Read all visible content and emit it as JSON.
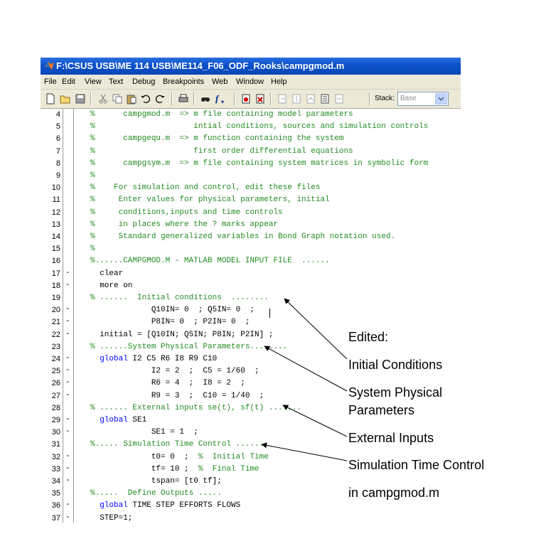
{
  "window": {
    "title": "F:\\CSUS USB\\ME 114 USB\\ME114_F06_ODF_Rooks\\campgmod.m"
  },
  "menu": [
    "File",
    "Edit",
    "View",
    "Text",
    "Debug",
    "Breakpoints",
    "Web",
    "Window",
    "Help"
  ],
  "toolbar": {
    "stack_label": "Stack:",
    "stack_value": "Base",
    "icons": [
      "new-file-icon",
      "open-folder-icon",
      "save-icon",
      "cut-icon",
      "copy-icon",
      "paste-icon",
      "undo-icon",
      "redo-icon",
      "print-icon",
      "find-icon",
      "function-icon",
      "set-breakpoint-icon",
      "clear-breakpoint-icon",
      "step-icon",
      "step-in-icon",
      "step-out-icon",
      "continue-icon",
      "exit-debug-icon"
    ]
  },
  "editor": {
    "lines": [
      {
        "num": "4",
        "dash": "",
        "code": "%      campgmod.m  => m file containing model parameters",
        "type": "comment"
      },
      {
        "num": "5",
        "dash": "",
        "code": "%                     intial conditions, sources and simulation controls",
        "type": "comment"
      },
      {
        "num": "6",
        "dash": "",
        "code": "%      campgequ.m  => m function containing the system",
        "type": "comment"
      },
      {
        "num": "7",
        "dash": "",
        "code": "%                     first order differential equations",
        "type": "comment"
      },
      {
        "num": "8",
        "dash": "",
        "code": "%      campgsym.m  => m file containing system matrices in symbolic form",
        "type": "comment"
      },
      {
        "num": "9",
        "dash": "",
        "code": "%",
        "type": "comment"
      },
      {
        "num": "10",
        "dash": "",
        "code": "%    For simulation and control, edit these files",
        "type": "comment"
      },
      {
        "num": "11",
        "dash": "",
        "code": "%     Enter values for physical parameters, initial",
        "type": "comment"
      },
      {
        "num": "12",
        "dash": "",
        "code": "%     conditions,inputs and time controls",
        "type": "comment"
      },
      {
        "num": "13",
        "dash": "",
        "code": "%     in places where the ? marks appear",
        "type": "comment"
      },
      {
        "num": "14",
        "dash": "",
        "code": "%     Standard generalized variables in Bond Graph notation used.",
        "type": "comment"
      },
      {
        "num": "15",
        "dash": "",
        "code": "%",
        "type": "comment"
      },
      {
        "num": "16",
        "dash": "",
        "code": "%......CAMPGMOD.M - MATLAB MODEL INPUT FILE  ......",
        "type": "comment"
      },
      {
        "num": "17",
        "dash": "-",
        "code": "  clear",
        "type": "code"
      },
      {
        "num": "18",
        "dash": "-",
        "code": "  more on",
        "type": "code"
      },
      {
        "num": "19",
        "dash": "",
        "code": "% ......  Initial conditions  ........",
        "type": "comment"
      },
      {
        "num": "20",
        "dash": "-",
        "code": "             Q10IN= 0  ; Q5IN= 0  ;",
        "type": "code"
      },
      {
        "num": "21",
        "dash": "-",
        "code": "             P8IN= 0  ; P2IN= 0  ;",
        "type": "code"
      },
      {
        "num": "22",
        "dash": "-",
        "code": "  initial = [Q10IN; Q5IN; P8IN; P2IN] ;",
        "type": "code"
      },
      {
        "num": "23",
        "dash": "",
        "code": "% ......System Physical Parameters........",
        "type": "comment"
      },
      {
        "num": "24",
        "dash": "-",
        "code": "  global I2 C5 R6 I8 R9 C10",
        "type": "global",
        "kw": "global",
        "rest": " I2 C5 R6 I8 R9 C10"
      },
      {
        "num": "25",
        "dash": "-",
        "code": "             I2 = 2  ;  C5 = 1/60  ;",
        "type": "code"
      },
      {
        "num": "26",
        "dash": "-",
        "code": "             R6 = 4  ;  I8 = 2  ;",
        "type": "code"
      },
      {
        "num": "27",
        "dash": "-",
        "code": "             R9 = 3  ;  C10 = 1/40  ;",
        "type": "code"
      },
      {
        "num": "28",
        "dash": "",
        "code": "% ...... External inputs se(t), sf(t) .......",
        "type": "comment"
      },
      {
        "num": "29",
        "dash": "-",
        "code": "  global SE1",
        "type": "global",
        "kw": "global",
        "rest": " SE1"
      },
      {
        "num": "30",
        "dash": "-",
        "code": "             SE1 = 1  ;",
        "type": "code"
      },
      {
        "num": "31",
        "dash": "",
        "code": "%..... Simulation Time Control ......",
        "type": "comment"
      },
      {
        "num": "32",
        "dash": "-",
        "code": "             t0= 0  ;  ",
        "type": "mixed",
        "comment": "%  Initial Time"
      },
      {
        "num": "33",
        "dash": "-",
        "code": "             tf= 10 ;  ",
        "type": "mixed",
        "comment": "%  Final Time"
      },
      {
        "num": "34",
        "dash": "-",
        "code": "             tspan= [t0 tf];",
        "type": "code"
      },
      {
        "num": "35",
        "dash": "",
        "code": "%.....  Define Outputs .....",
        "type": "comment"
      },
      {
        "num": "36",
        "dash": "-",
        "code": "  global TIME STEP EFFORTS FLOWS",
        "type": "global",
        "kw": "global",
        "rest": " TIME STEP EFFORTS FLOWS"
      },
      {
        "num": "37",
        "dash": "-",
        "code": "  STEP=1;",
        "type": "code"
      }
    ]
  },
  "annotations": {
    "edited": "Edited:",
    "initial_conditions": "Initial Conditions",
    "system_physical": "System Physical",
    "parameters": "Parameters",
    "external_inputs": "External Inputs",
    "simulation_time_control": "Simulation Time Control",
    "in_campgmod": "in campgmod.m"
  },
  "colors": {
    "comment": "#228b22",
    "keyword": "#0000ff",
    "titlebar": "#0b50c8",
    "chrome": "#ece9d8"
  }
}
